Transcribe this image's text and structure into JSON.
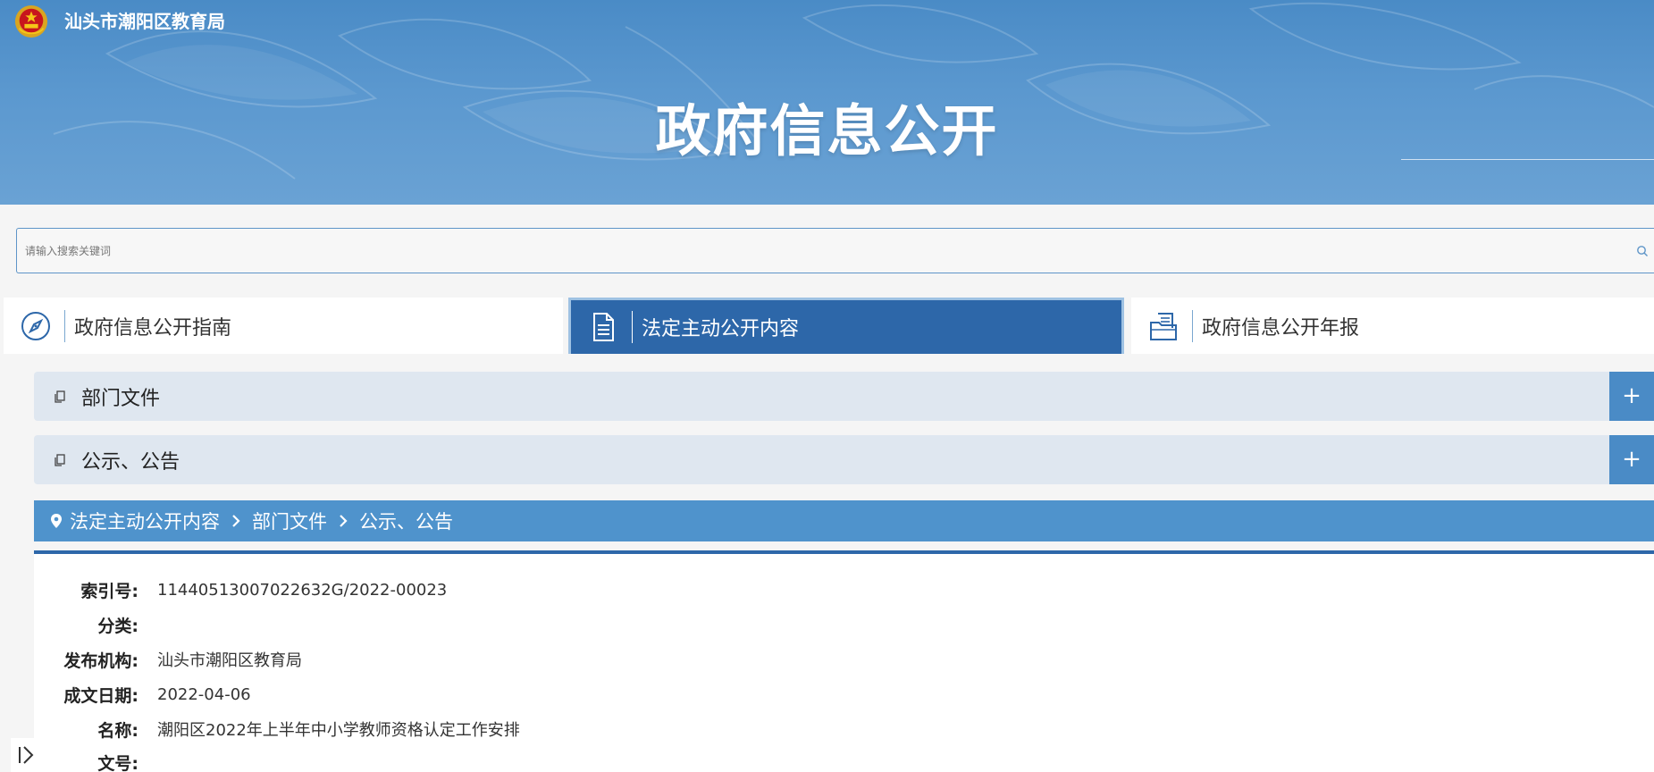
{
  "header": {
    "site_name": "汕头市潮阳区教育局",
    "page_title": "政府信息公开"
  },
  "search": {
    "placeholder": "请输入搜索关键词",
    "value": ""
  },
  "tabs": [
    {
      "label": "政府信息公开指南",
      "icon": "compass-icon",
      "active": false
    },
    {
      "label": "法定主动公开内容",
      "icon": "document-icon",
      "active": true
    },
    {
      "label": "政府信息公开年报",
      "icon": "folder-report-icon",
      "active": false
    }
  ],
  "categories": [
    {
      "label": "部门文件",
      "expand_label": "+"
    },
    {
      "label": "公示、公告",
      "expand_label": "+"
    }
  ],
  "breadcrumb": [
    "法定主动公开内容",
    "部门文件",
    "公示、公告"
  ],
  "info": [
    {
      "key": "索引号:",
      "value": "11440513007022632G/2022-00023"
    },
    {
      "key": "分类:",
      "value": ""
    },
    {
      "key": "发布机构:",
      "value": "汕头市潮阳区教育局"
    },
    {
      "key": "成文日期:",
      "value": "2022-04-06"
    },
    {
      "key": "名称:",
      "value": "潮阳区2022年上半年中小学教师资格认定工作安排"
    },
    {
      "key": "文号:",
      "value": ""
    }
  ],
  "colors": {
    "header_blue": "#4a8bc6",
    "active_tab": "#2d67a9",
    "category_bg": "#dfe7f0",
    "breadcrumb_bg": "#4f93cc"
  }
}
